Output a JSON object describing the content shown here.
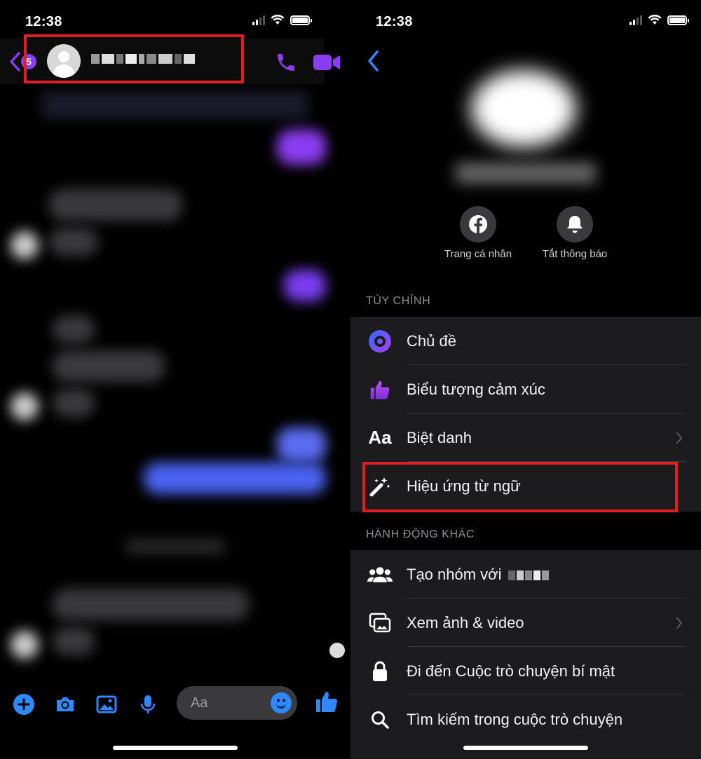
{
  "left": {
    "status": {
      "time": "12:38"
    },
    "header": {
      "back_badge": "5"
    },
    "composer": {
      "placeholder": "Aa"
    }
  },
  "right": {
    "status": {
      "time": "12:38"
    },
    "actions": [
      {
        "label": "Trang cá nhân",
        "icon": "facebook-icon"
      },
      {
        "label": "Tắt thông báo",
        "icon": "bell-icon"
      }
    ],
    "customize": {
      "title": "TÙY CHỈNH",
      "items": [
        {
          "label": "Chủ đề",
          "icon": "theme-icon"
        },
        {
          "label": "Biểu tượng cảm xúc",
          "icon": "thumbs-up-icon"
        },
        {
          "label": "Biệt danh",
          "icon": "nickname-icon",
          "icon_text": "Aa"
        },
        {
          "label": "Hiệu ứng từ ngữ",
          "icon": "magic-wand-icon"
        }
      ]
    },
    "more": {
      "title": "HÀNH ĐỘNG KHÁC",
      "items": [
        {
          "label": "Tạo nhóm với",
          "icon": "group-icon"
        },
        {
          "label": "Xem ảnh & video",
          "icon": "photos-icon"
        },
        {
          "label": "Đi đến Cuộc trò chuyện bí mật",
          "icon": "lock-icon"
        },
        {
          "label": "Tìm kiếm trong cuộc trò chuyện",
          "icon": "search-icon"
        }
      ]
    }
  },
  "colors": {
    "accent_purple": "#8a3cf0",
    "accent_blue": "#2e89ff",
    "highlight_red": "#e41b23",
    "group_bg": "#1c1c1e"
  }
}
